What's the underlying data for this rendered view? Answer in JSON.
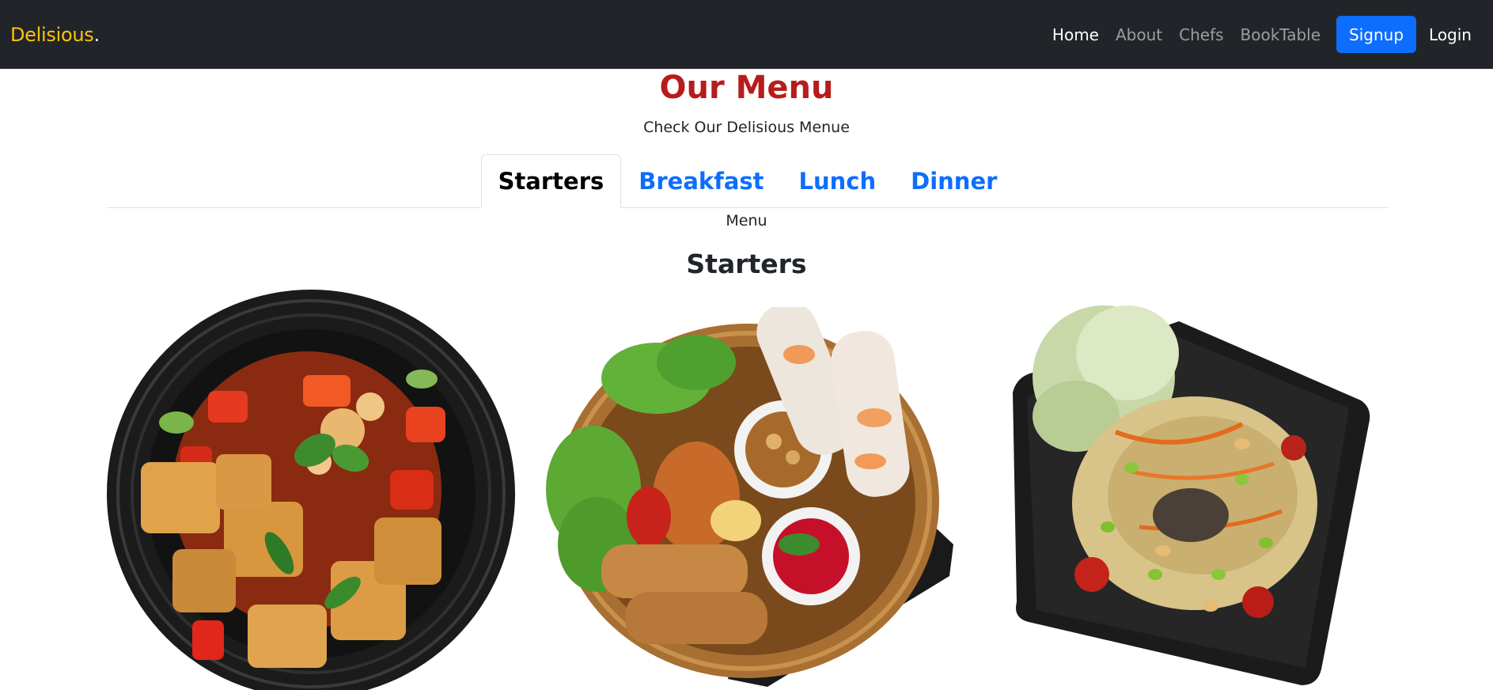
{
  "navbar": {
    "brand": "Delisious",
    "brand_dot": ".",
    "links": [
      {
        "label": "Home"
      },
      {
        "label": "About"
      },
      {
        "label": "Chefs"
      },
      {
        "label": "BookTable"
      }
    ],
    "signup_label": "Signup",
    "login_label": "Login"
  },
  "main": {
    "title": "Our Menu",
    "subtitle": "Check Our Delisious Menue",
    "tabs": [
      {
        "label": "Starters"
      },
      {
        "label": "Breakfast"
      },
      {
        "label": "Lunch"
      },
      {
        "label": "Dinner"
      }
    ],
    "menu_label": "Menu",
    "section_title": "Starters"
  },
  "colors": {
    "navbar_bg": "#212529",
    "brand": "#ffc107",
    "accent": "#0d6efd",
    "title": "#b71c1c"
  }
}
